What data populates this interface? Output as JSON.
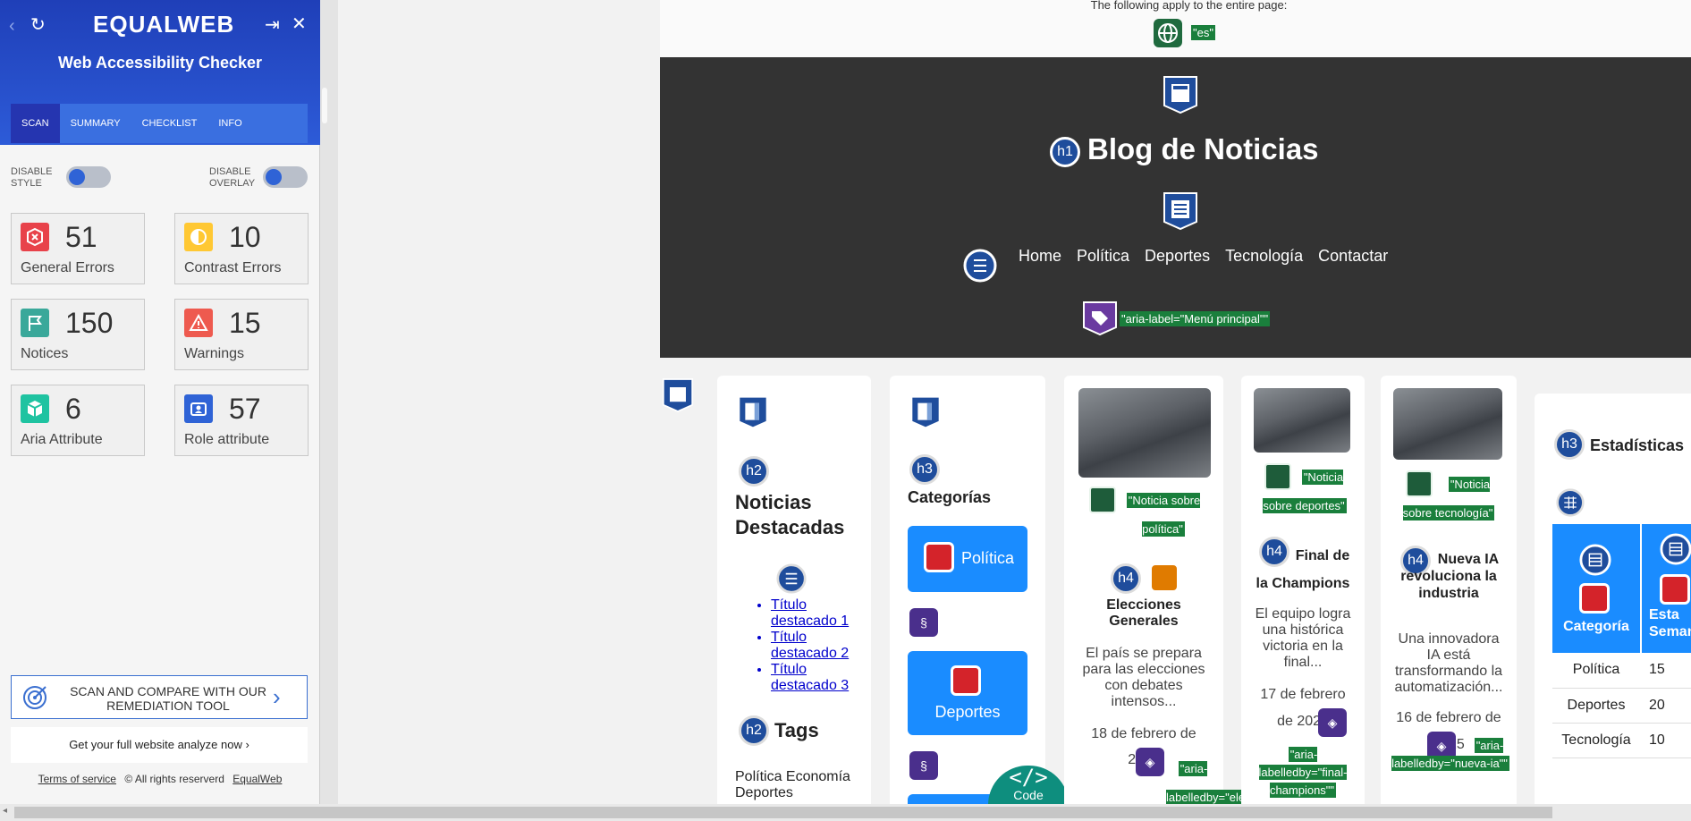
{
  "panel": {
    "brand": "EQUALWEB",
    "title": "Web Accessibility Checker",
    "tabs": [
      "SCAN",
      "SUMMARY",
      "CHECKLIST",
      "INFO"
    ],
    "toggles": {
      "left": "DISABLE STYLE",
      "right": "DISABLE OVERLAY"
    },
    "stats": [
      {
        "value": "51",
        "label": "General Errors",
        "icon": "error-hexagon-icon",
        "color": "#e8424a"
      },
      {
        "value": "10",
        "label": "Contrast Errors",
        "icon": "contrast-icon",
        "color": "#ffc833"
      },
      {
        "value": "150",
        "label": "Notices",
        "icon": "flag-icon",
        "color": "#3aa89a"
      },
      {
        "value": "15",
        "label": "Warnings",
        "icon": "warning-icon",
        "color": "#ee5a4f"
      },
      {
        "value": "6",
        "label": "Aria Attribute",
        "icon": "cube-icon",
        "color": "#1fc3a1"
      },
      {
        "value": "57",
        "label": "Role attribute",
        "icon": "id-card-icon",
        "color": "#2f63d6"
      }
    ],
    "scan_compare": "SCAN AND COMPARE WITH OUR REMEDIATION TOOL",
    "get_full": "Get your full website analyze now ›",
    "footer": {
      "terms": "Terms of service",
      "rights": "© All rights reserverd",
      "brand": "EqualWeb"
    }
  },
  "page": {
    "apply_text": "The following apply to the entire page:",
    "lang_tag": "\"es\"",
    "site_title": "Blog de Noticias",
    "h1": "h1",
    "nav": [
      "Home",
      "Política",
      "Deportes",
      "Tecnología",
      "Contactar"
    ],
    "nav_aria": "\"aria-label=\"Menú principal\"\"",
    "featured": {
      "h": "h2",
      "title": "Noticias Destacadas",
      "items": [
        "Título destacado 1",
        "Título destacado 2",
        "Título destacado 3"
      ],
      "tags_h": "h2",
      "tags_title": "Tags",
      "tags": "Política Economía Deportes"
    },
    "categories": {
      "h": "h3",
      "title": "Categorías",
      "buttons": [
        "Política",
        "Deportes"
      ]
    },
    "articles": [
      {
        "alt": "\"Noticia sobre política\"",
        "h": "h4",
        "title": "Elecciones Generales",
        "text": "El país se prepara para las elecciones con debates intensos...",
        "date": "18 de febrero de 2025",
        "aria": "\"aria-labelledby=\"elecciones-"
      },
      {
        "alt": "\"Noticia sobre deportes\"",
        "h": "h4",
        "title": "Final de la Champions",
        "text": "El equipo logra una histórica victoria en la final...",
        "date": "17 de febrero de 2025",
        "aria": "\"aria-labelledby=\"final-champions\"\""
      },
      {
        "alt": "\"Noticia sobre tecnología\"",
        "h": "h4",
        "title": "Nueva IA revoluciona la industria",
        "text": "Una innovadora IA está transformando la automatización...",
        "date": "16 de febrero de 2025",
        "aria": "\"aria-labelledby=\"nueva-ia\"\""
      }
    ],
    "stats_box": {
      "h": "h3",
      "title": "Estadísticas",
      "head_cols": [
        "Categoría",
        "Esta Semana"
      ],
      "rows": [
        [
          "Política",
          "15"
        ],
        [
          "Deportes",
          "20"
        ],
        [
          "Tecnología",
          "10"
        ]
      ]
    },
    "code_label": "Code"
  },
  "colors": {
    "brand_blue": "#2d5bd8",
    "header_dark": "#333333",
    "tag_green": "#1a7f3c",
    "button_blue": "#1a8cff"
  }
}
